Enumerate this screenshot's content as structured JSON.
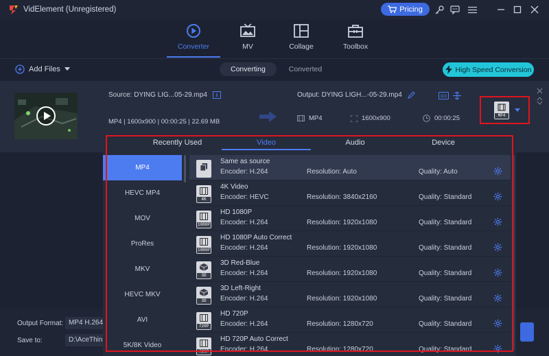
{
  "titlebar": {
    "title": "VidElement (Unregistered)",
    "pricing_label": "Pricing"
  },
  "nav": [
    {
      "label": "Converter",
      "icon": "converter-icon",
      "active": true
    },
    {
      "label": "MV",
      "icon": "mv-icon"
    },
    {
      "label": "Collage",
      "icon": "collage-icon"
    },
    {
      "label": "Toolbox",
      "icon": "toolbox-icon"
    }
  ],
  "toolbar": {
    "add_files": "Add Files",
    "tabs": [
      "Converting",
      "Converted"
    ],
    "high_speed": "High Speed Conversion"
  },
  "file": {
    "source": "Source: DYING LIG...05-29.mp4",
    "source_meta": "MP4 | 1600x900 | 00:00:25 | 22.69 MB",
    "output": "Output: DYING LIGH...-05-29.mp4",
    "out_format": "MP4",
    "out_resolution": "1600x900",
    "out_duration": "00:00:25",
    "format_badge": "MP4"
  },
  "bottom": {
    "output_format_label": "Output Format:",
    "output_format_value": "MP4 H.264",
    "save_to_label": "Save to:",
    "save_to_value": "D:\\AceThin"
  },
  "popup": {
    "tabs": [
      "Recently Used",
      "Video",
      "Audio",
      "Device"
    ],
    "active_tab": "Video",
    "categories": [
      "MP4",
      "HEVC MP4",
      "MOV",
      "ProRes",
      "MKV",
      "HEVC MKV",
      "AVI",
      "5K/8K Video"
    ],
    "presets": [
      {
        "name": "Same as source",
        "encoder": "Encoder: H.264",
        "resolution": "Resolution: Auto",
        "quality": "Quality: Auto",
        "badge": ""
      },
      {
        "name": "4K Video",
        "encoder": "Encoder: HEVC",
        "resolution": "Resolution: 3840x2160",
        "quality": "Quality: Standard",
        "badge": "4K"
      },
      {
        "name": "HD 1080P",
        "encoder": "Encoder: H.264",
        "resolution": "Resolution: 1920x1080",
        "quality": "Quality: Standard",
        "badge": "1080P"
      },
      {
        "name": "HD 1080P Auto Correct",
        "encoder": "Encoder: H.264",
        "resolution": "Resolution: 1920x1080",
        "quality": "Quality: Standard",
        "badge": "1080P"
      },
      {
        "name": "3D Red-Blue",
        "encoder": "Encoder: H.264",
        "resolution": "Resolution: 1920x1080",
        "quality": "Quality: Standard",
        "badge": "3D"
      },
      {
        "name": "3D Left-Right",
        "encoder": "Encoder: H.264",
        "resolution": "Resolution: 1920x1080",
        "quality": "Quality: Standard",
        "badge": "3D"
      },
      {
        "name": "HD 720P",
        "encoder": "Encoder: H.264",
        "resolution": "Resolution: 1280x720",
        "quality": "Quality: Standard",
        "badge": "720P"
      },
      {
        "name": "HD 720P Auto Correct",
        "encoder": "Encoder: H.264",
        "resolution": "Resolution: 1280x720",
        "quality": "Quality: Standard",
        "badge": "720P"
      }
    ]
  }
}
